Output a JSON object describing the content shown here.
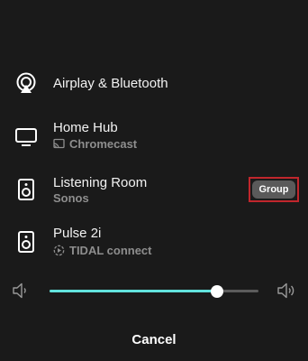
{
  "devices": [
    {
      "name": "Airplay & Bluetooth",
      "subtitle": "",
      "icon": "airplay-icon"
    },
    {
      "name": "Home Hub",
      "subtitle": "Chromecast",
      "icon": "tv-icon",
      "subtitle_icon": "cast-icon"
    },
    {
      "name": "Listening Room",
      "subtitle": "Sonos",
      "icon": "speaker-icon"
    },
    {
      "name": "Pulse 2i",
      "subtitle": "TIDAL connect",
      "icon": "speaker-icon",
      "subtitle_icon": "tidal-connect-icon"
    }
  ],
  "group_button": {
    "label": "Group"
  },
  "volume": {
    "level": 0.8,
    "min_icon": "volume-low-icon",
    "max_icon": "volume-high-icon"
  },
  "cancel": {
    "label": "Cancel"
  },
  "colors": {
    "accent": "#62e3dd",
    "highlight": "#c0262c",
    "background": "#1a1a1a"
  }
}
